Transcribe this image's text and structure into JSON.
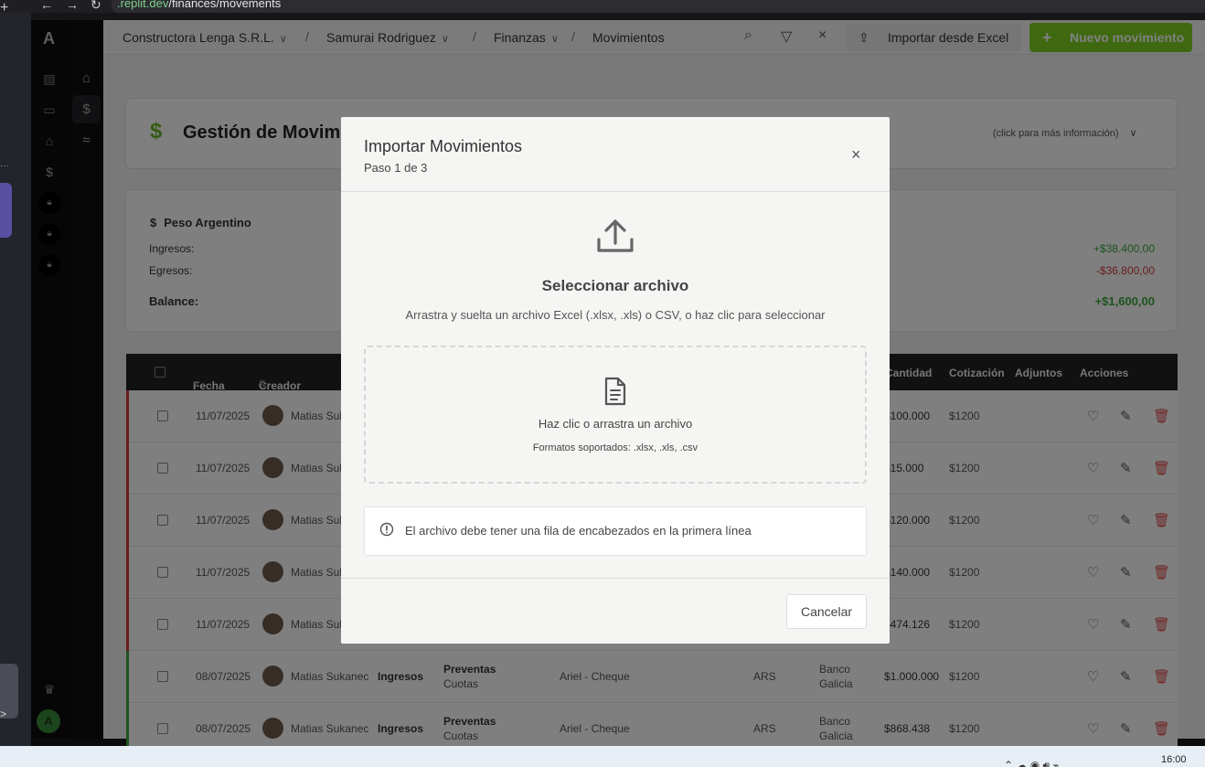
{
  "browser": {
    "back": "←",
    "forward": "→",
    "reload": "↻",
    "url_domain": ".replit.dev",
    "url_path": "/finances/movements"
  },
  "sidebar": {
    "logo": "A",
    "avatar": "A"
  },
  "topbar": {
    "breadcrumbs": [
      "Constructora Lenga S.R.L.",
      "Samurai Rodriguez",
      "Finanzas",
      "Movimientos"
    ],
    "import_label": "Importar desde Excel",
    "new_label": "Nuevo movimiento"
  },
  "header_card": {
    "title": "Gestión de Movimientos",
    "info": "(click para más información)"
  },
  "balance": {
    "currency": "Peso Argentino",
    "income_label": "Ingresos:",
    "income_value": "+$38.400,00",
    "expense_label": "Egresos:",
    "expense_value": "-$36.800,00",
    "balance_label": "Balance:",
    "balance_value": "+$1,600,00"
  },
  "table": {
    "headers": {
      "fecha": "Fecha",
      "creador": "Creador",
      "cantidad": "Cantidad",
      "cotizacion": "Cotización",
      "adjuntos": "Adjuntos",
      "acciones": "Acciones"
    },
    "rows": [
      {
        "date": "11/07/2025",
        "creator": "Matias Sukanec",
        "type": "",
        "category": "",
        "subcategory": "",
        "detail": "",
        "currency": "",
        "bank": "",
        "bank2": "",
        "amount": "$100.000",
        "rate": "$1200",
        "color": "#d23a3a"
      },
      {
        "date": "11/07/2025",
        "creator": "Matias Sukanec",
        "type": "",
        "category": "",
        "subcategory": "",
        "detail": "",
        "currency": "",
        "bank": "",
        "bank2": "",
        "amount": "$15.000",
        "rate": "$1200",
        "color": "#d23a3a"
      },
      {
        "date": "11/07/2025",
        "creator": "Matias Sukanec",
        "type": "",
        "category": "",
        "subcategory": "",
        "detail": "",
        "currency": "",
        "bank": "",
        "bank2": "",
        "amount": "$120.000",
        "rate": "$1200",
        "color": "#d23a3a"
      },
      {
        "date": "11/07/2025",
        "creator": "Matias Sukanec",
        "type": "",
        "category": "",
        "subcategory": "",
        "detail": "",
        "currency": "",
        "bank": "",
        "bank2": "",
        "amount": "$140.000",
        "rate": "$1200",
        "color": "#d23a3a"
      },
      {
        "date": "11/07/2025",
        "creator": "Matias Sukanec",
        "type": "",
        "category": "",
        "subcategory": "",
        "detail": "",
        "currency": "",
        "bank": "",
        "bank2": "",
        "amount": "$474.126",
        "rate": "$1200",
        "color": "#d23a3a"
      },
      {
        "date": "08/07/2025",
        "creator": "Matias Sukanec",
        "type": "Ingresos",
        "category": "Preventas",
        "subcategory": "Cuotas",
        "detail": "Ariel - Cheque",
        "currency": "ARS",
        "bank": "Banco",
        "bank2": "Galicia",
        "amount": "$1.000.000",
        "rate": "$1200",
        "color": "#3aa83a"
      },
      {
        "date": "08/07/2025",
        "creator": "Matias Sukanec",
        "type": "Ingresos",
        "category": "Preventas",
        "subcategory": "Cuotas",
        "detail": "Ariel - Cheque",
        "currency": "ARS",
        "bank": "Banco",
        "bank2": "Galicia",
        "amount": "$868.438",
        "rate": "$1200",
        "color": "#3aa83a"
      }
    ]
  },
  "modal": {
    "title": "Importar Movimientos",
    "step": "Paso 1 de 3",
    "close": "×",
    "select_title": "Seleccionar archivo",
    "select_desc": "Arrastra y suelta un archivo Excel (.xlsx, .xls) o CSV, o haz clic para seleccionar",
    "dropzone_text": "Haz clic o arrastra un archivo",
    "formats": "Formatos soportados: .xlsx, .xls, .csv",
    "notice": "El archivo debe tener una fila de encabezados en la primera línea",
    "cancel": "Cancelar"
  },
  "taskbar": {
    "time": "16:00"
  },
  "colors": {
    "accent_green": "#7ed320",
    "income": "#3aa83a",
    "expense": "#d23a3a"
  }
}
